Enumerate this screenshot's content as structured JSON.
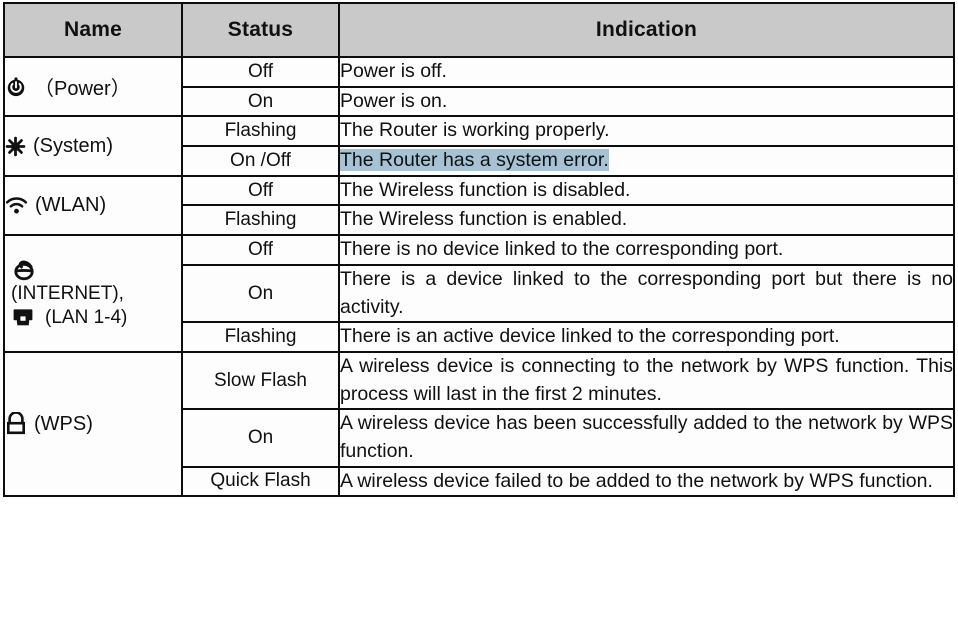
{
  "table": {
    "headers": {
      "name": "Name",
      "status": "Status",
      "indication": "Indication"
    },
    "groups": [
      {
        "icon": "power-icon",
        "name_label": "（Power）",
        "rows": [
          {
            "status": "Off",
            "indication": "Power is off."
          },
          {
            "status": "On",
            "indication": "Power is on."
          }
        ]
      },
      {
        "icon": "gear-icon",
        "name_label": "(System)",
        "rows": [
          {
            "status": "Flashing",
            "indication": "The Router is working properly."
          },
          {
            "status": "On /Off",
            "indication": "The Router has a system error.",
            "highlighted": true
          }
        ]
      },
      {
        "icon": "wifi-icon",
        "name_label": "(WLAN)",
        "rows": [
          {
            "status": "Off",
            "indication": "The Wireless function is disabled."
          },
          {
            "status": "Flashing",
            "indication": "The Wireless function is enabled."
          }
        ]
      },
      {
        "icon": "globe-icon",
        "icon2": "lan-port-icon",
        "name_label": "(INTERNET),",
        "name_label2": "(LAN 1-4)",
        "rows": [
          {
            "status": "Off",
            "indication": "There is no device linked to the corresponding port."
          },
          {
            "status": "On",
            "indication": "There is a device linked to the corresponding port but there is no activity."
          },
          {
            "status": "Flashing",
            "indication": "There is an active device linked to the corresponding port."
          }
        ]
      },
      {
        "icon": "lock-icon",
        "name_label": "(WPS)",
        "rows": [
          {
            "status": "Slow Flash",
            "indication": "A wireless device is connecting to the network by WPS function. This process will last in the first 2 minutes."
          },
          {
            "status": "On",
            "indication": "A wireless device has been successfully added to the network by WPS function."
          },
          {
            "status": "Quick Flash",
            "indication": "A wireless device failed to be added to the network by WPS function."
          }
        ]
      }
    ]
  },
  "colors": {
    "header_background": "#c9c9c9",
    "border": "#0d0d0d",
    "highlight": "#a6c3d6",
    "text": "#111111"
  }
}
